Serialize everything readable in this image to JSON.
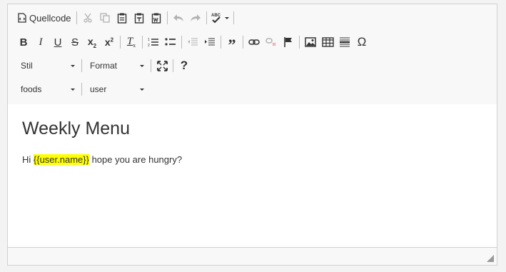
{
  "toolbar": {
    "source_label": "Quellcode",
    "style_combo": "Stil",
    "format_combo": "Format",
    "foods_combo": "foods",
    "user_combo": "user",
    "help_label": "?"
  },
  "content": {
    "heading": "Weekly Menu",
    "greeting_prefix": "Hi ",
    "placeholder": "{{user.name}}",
    "greeting_suffix": " hope you are hungry?"
  },
  "colors": {
    "highlight": "#ffff00",
    "border": "#d1d1d1",
    "toolbar_bg": "#f8f8f8"
  }
}
